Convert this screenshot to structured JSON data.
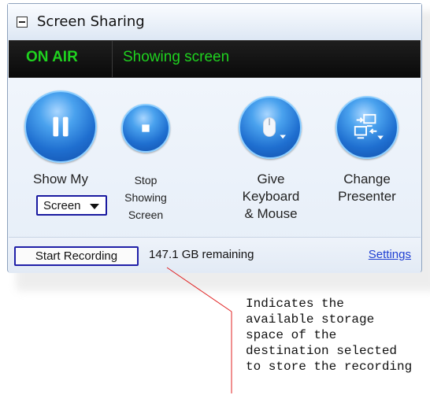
{
  "panel": {
    "title": "Screen Sharing",
    "status": {
      "on_air": "ON AIR",
      "showing": "Showing screen"
    },
    "controls": {
      "show_my": {
        "label_top": "Show My",
        "select_value": "Screen"
      },
      "stop": {
        "line1": "Stop",
        "line2": "Showing",
        "line3": "Screen"
      },
      "give": {
        "line1": "Give",
        "line2": "Keyboard",
        "line3": "& Mouse"
      },
      "change": {
        "line1": "Change",
        "line2": "Presenter"
      }
    },
    "footer": {
      "record_label": "Start Recording",
      "remaining": "147.1 GB remaining",
      "settings_label": "Settings"
    }
  },
  "annotation": {
    "line1": "Indicates the",
    "line2": "available storage",
    "line3": "space of the",
    "line4": "destination selected",
    "line5": "to store the recording"
  },
  "colors": {
    "status_green": "#1fd21f",
    "button_blue": "#1f6fd0",
    "link_blue": "#1f3fd2",
    "callout_red": "#e02020"
  },
  "icons": [
    "minus-icon",
    "pause-icon",
    "stop-icon",
    "mouse-icon",
    "change-presenter-icon",
    "chevron-down-icon"
  ]
}
